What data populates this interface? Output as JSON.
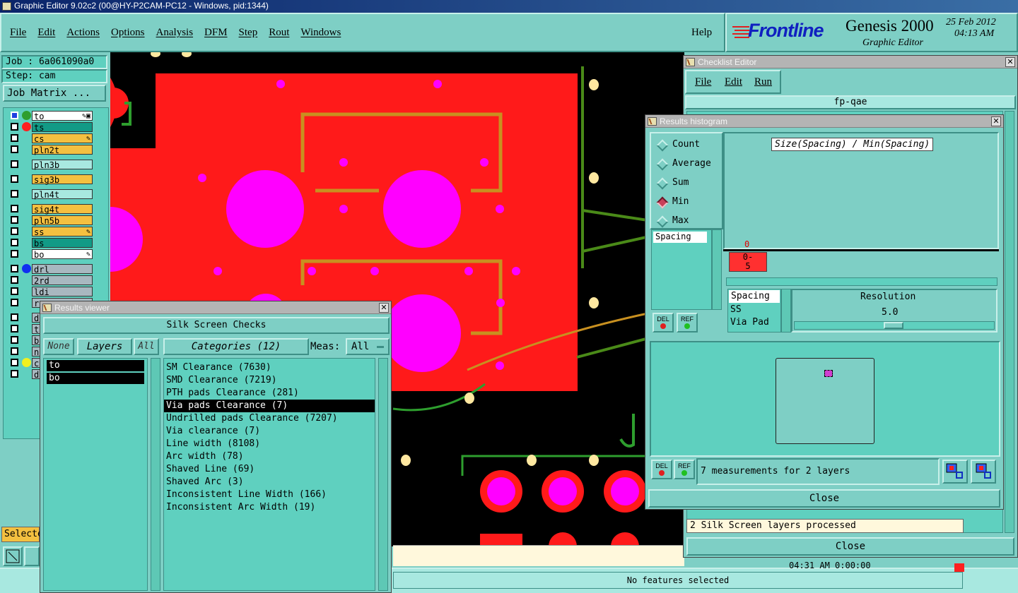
{
  "app": {
    "window_title": "Graphic Editor 9.02c2 (00@HY-P2CAM-PC12 - Windows, pid:1344)",
    "menu": [
      "File",
      "Edit",
      "Actions",
      "Options",
      "Analysis",
      "DFM",
      "Step",
      "Rout",
      "Windows"
    ],
    "help": "Help",
    "brand": "Frontline",
    "product": "Genesis 2000",
    "subtitle": "Graphic Editor",
    "date": "25 Feb 2012",
    "time": "04:13 AM"
  },
  "left_panel": {
    "job": "Job : 6a061090a0",
    "step": "Step: cam",
    "job_matrix": "Job Matrix ...",
    "selected_label": "Selecte",
    "layers": [
      {
        "name": "to",
        "color": "#ffffff",
        "dot": "#2e9e2e",
        "mark": "✎▣"
      },
      {
        "name": "ts",
        "color": "#129a86",
        "dot": "#ff2020",
        "mark": ""
      },
      {
        "name": "cs",
        "color": "#f4c040",
        "dot": "",
        "mark": "✎"
      },
      {
        "name": "pln2t",
        "color": "#f4c040",
        "dot": "",
        "mark": ""
      },
      {
        "name": "pln3b",
        "color": "#a8e8e0",
        "dot": "",
        "mark": ""
      },
      {
        "name": "sig3b",
        "color": "#f4c040",
        "dot": "",
        "mark": ""
      },
      {
        "name": "pln4t",
        "color": "#a8e8e0",
        "dot": "",
        "mark": ""
      },
      {
        "name": "sig4t",
        "color": "#f4c040",
        "dot": "",
        "mark": ""
      },
      {
        "name": "pln5b",
        "color": "#f4c040",
        "dot": "",
        "mark": ""
      },
      {
        "name": "ss",
        "color": "#f4c040",
        "dot": "",
        "mark": "✎"
      },
      {
        "name": "bs",
        "color": "#129a86",
        "dot": "",
        "mark": ""
      },
      {
        "name": "bo",
        "color": "#ffffff",
        "dot": "",
        "mark": "✎"
      },
      {
        "name": "drl",
        "color": "#a8b8c0",
        "dot": "#1030f0",
        "mark": ""
      },
      {
        "name": "2rd",
        "color": "#a8b8c0",
        "dot": "",
        "mark": ""
      },
      {
        "name": "ldi",
        "color": "#a8b8c0",
        "dot": "",
        "mark": ""
      },
      {
        "name": "ro",
        "color": "#a8b8c0",
        "dot": "",
        "mark": ""
      },
      {
        "name": "du",
        "color": "#a8b8c0",
        "dot": "",
        "mark": ""
      },
      {
        "name": "tp",
        "color": "#a8b8c0",
        "dot": "",
        "mark": ""
      },
      {
        "name": "bp",
        "color": "#a8b8c0",
        "dot": "",
        "mark": ""
      },
      {
        "name": "np",
        "color": "#a8b8c0",
        "dot": "",
        "mark": ""
      },
      {
        "name": "cv",
        "color": "#a8b8c0",
        "dot": "#f0f020",
        "mark": ""
      },
      {
        "name": "d",
        "color": "#a8b8c0",
        "dot": "",
        "mark": ""
      }
    ]
  },
  "results_viewer": {
    "title": "Results viewer",
    "header": "Silk Screen Checks",
    "none_btn": "None",
    "layers_btn": "Layers",
    "all_btn": "All",
    "categories_btn": "Categories (12)",
    "meas_label": "Meas:",
    "meas_value": "All",
    "layers": [
      "to",
      "bo"
    ],
    "categories": [
      "SM Clearance (7630)",
      "SMD Clearance (7219)",
      "PTH pads Clearance (281)",
      "Via pads Clearance (7)",
      "Undrilled pads Clearance (7207)",
      "Via clearance (7)",
      "Line width (8108)",
      "Arc width (78)",
      "Shaved Line (69)",
      "Shaved Arc (3)",
      "Inconsistent Line Width (166)",
      "Inconsistent Arc Width (19)"
    ],
    "selected_category": 3
  },
  "checklist_editor": {
    "title": "Checklist Editor",
    "menu": [
      "File",
      "Edit",
      "Run"
    ],
    "checklist_name": "fp-qae",
    "partial_row": "04:31 AM   0:00:00",
    "status": "2 Silk Screen layers processed",
    "close": "Close"
  },
  "histogram": {
    "title": "Results histogram",
    "modes": [
      "Count",
      "Average",
      "Sum",
      "Min",
      "Max"
    ],
    "selected_mode": "Min",
    "chart_title": "Size(Spacing) / Min(Spacing)",
    "bar_value": "0",
    "bin_label": "0-\n5",
    "list_left": [
      "Spacing"
    ],
    "list_right": [
      "Spacing",
      "SS",
      "Via Pad"
    ],
    "resolution_label": "Resolution",
    "resolution_value": "5.0",
    "del": "DEL",
    "ref": "REF",
    "measurements": "7 measurements for 2 layers",
    "close": "Close"
  },
  "status_bar": {
    "text": "No features selected"
  }
}
